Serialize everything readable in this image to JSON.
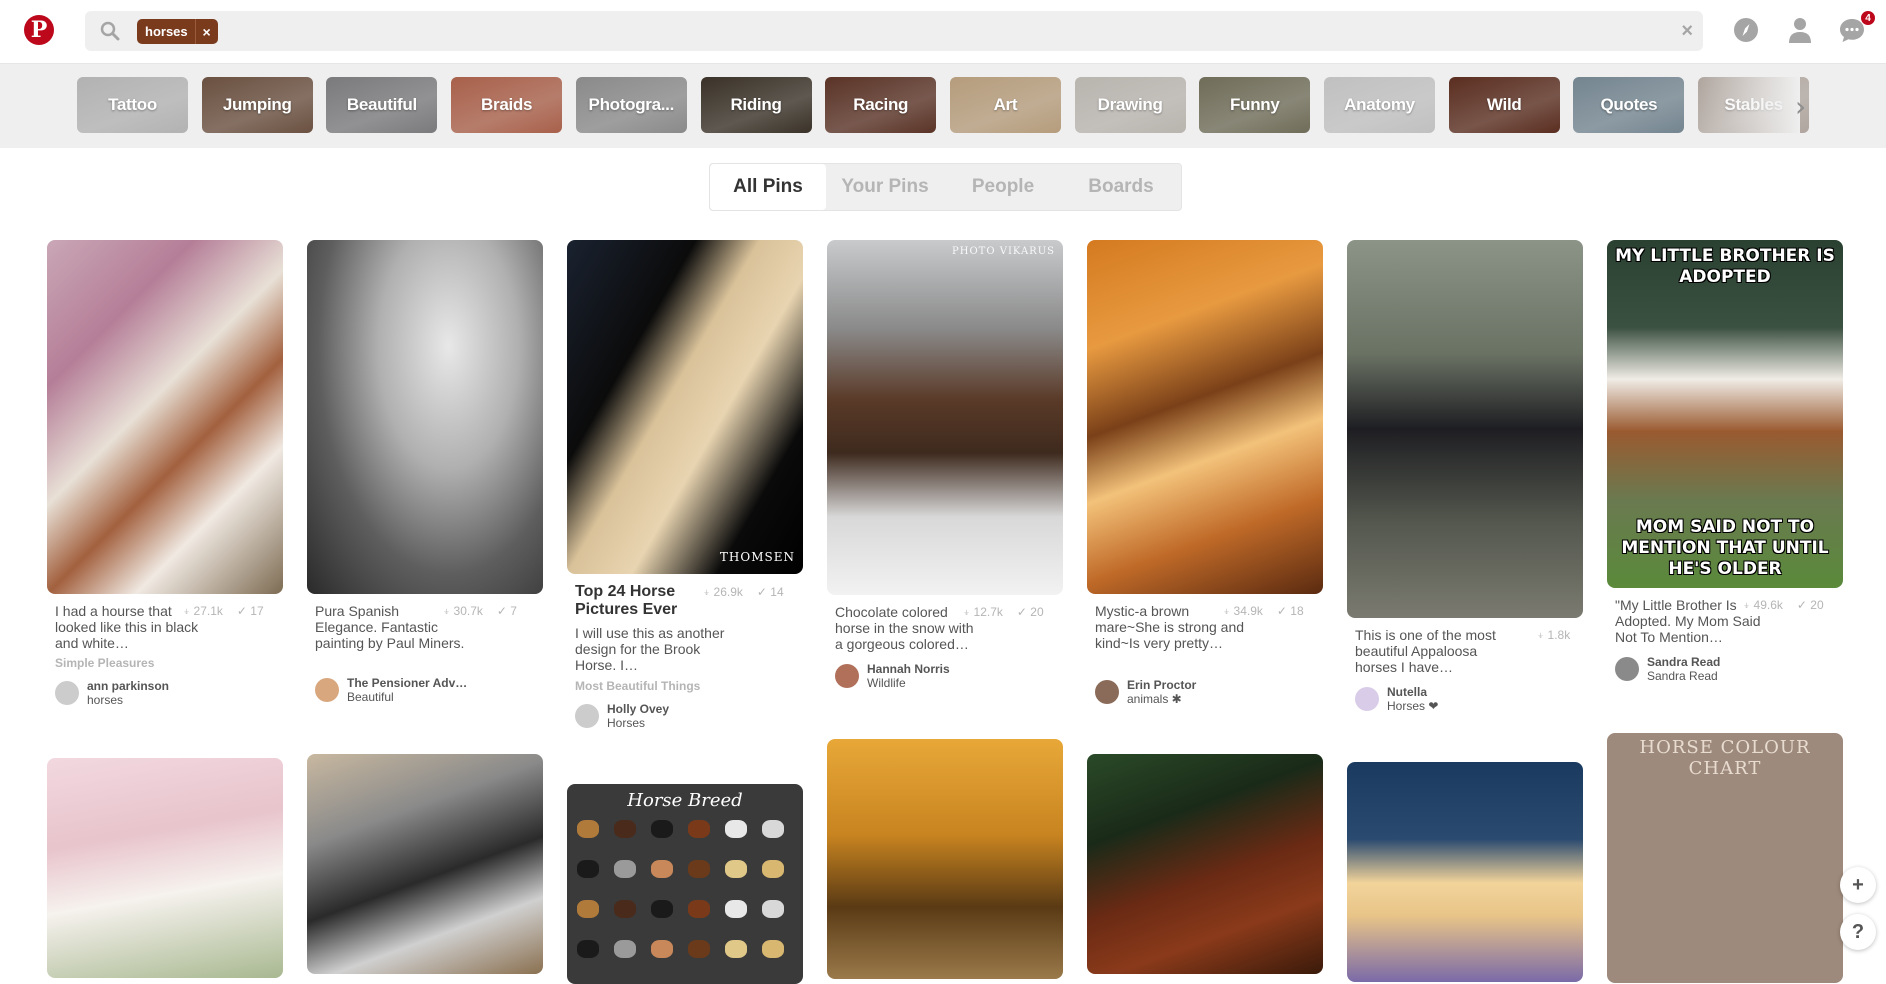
{
  "header": {
    "logo_glyph": "P",
    "search_chip": "horses",
    "chip_remove": "×",
    "clear_search": "×",
    "notification_count": "4",
    "brand_color": "#bd081c",
    "chip_color": "#7a3b1d",
    "icons": [
      "pinterest-logo",
      "search-icon",
      "compass-icon",
      "profile-icon",
      "messages-icon"
    ]
  },
  "guides": [
    {
      "label": "Tattoo",
      "color": "#b2b2b2"
    },
    {
      "label": "Jumping",
      "color": "#6a5040"
    },
    {
      "label": "Beautiful",
      "color": "#7a7a7c"
    },
    {
      "label": "Braids",
      "color": "#a8604a"
    },
    {
      "label": "Photogra...",
      "color": "#8a8a8a"
    },
    {
      "label": "Riding",
      "color": "#3a3228"
    },
    {
      "label": "Racing",
      "color": "#5a3326"
    },
    {
      "label": "Art",
      "color": "#b59c7c"
    },
    {
      "label": "Drawing",
      "color": "#b8b4ae"
    },
    {
      "label": "Funny",
      "color": "#6f6c58"
    },
    {
      "label": "Anatomy",
      "color": "#c0c0c0"
    },
    {
      "label": "Wild",
      "color": "#5a2e20"
    },
    {
      "label": "Quotes",
      "color": "#748590"
    },
    {
      "label": "Stables",
      "color": "#b0a69f"
    }
  ],
  "guide_next": "›",
  "tabs": [
    {
      "label": "All Pins",
      "active": true
    },
    {
      "label": "Your Pins",
      "active": false
    },
    {
      "label": "People",
      "active": false
    },
    {
      "label": "Boards",
      "active": false
    }
  ],
  "pins": [
    {
      "description": "I had a hourse that looked like this in black and white…",
      "repins": "27.1k",
      "likes": "17",
      "board": "Simple Pleasures",
      "user": "ann parkinson",
      "user_board": "horses",
      "image": "appaloosa-horse-blossoms"
    },
    {
      "description": "Pura Spanish Elegance. Fantastic painting by Paul Miners.",
      "repins": "30.7k",
      "likes": "7",
      "board": "",
      "user": "The Pensioner Adv…",
      "user_board": "Beautiful",
      "image": "grey-spanish-horse-painting"
    },
    {
      "title": "Top 24 Horse Pictures Ever",
      "description": "I will use this as another design for the Brook Horse. I…",
      "repins": "26.9k",
      "likes": "14",
      "board": "Most Beautiful Things",
      "user": "Holly Ovey",
      "user_board": "Horses",
      "image": "buckskin-horse-bridle",
      "watermark": "THOMSEN"
    },
    {
      "description": "Chocolate colored horse in the snow with a gorgeous colored…",
      "repins": "12.7k",
      "likes": "20",
      "board": "",
      "user": "Hannah Norris",
      "user_board": "Wildlife",
      "image": "chocolate-horse-snow",
      "watermark": "PHOTO VIKARUS"
    },
    {
      "description": "Mystic-a brown mare~She is strong and kind~Is very pretty…",
      "repins": "34.9k",
      "likes": "18",
      "board": "",
      "user": "Erin Proctor",
      "user_board": "animals ✱",
      "image": "chestnut-mare-autumn"
    },
    {
      "description": "This is one of the most beautiful Appaloosa horses I have…",
      "repins": "1.8k",
      "likes": "",
      "board": "",
      "user": "Nutella",
      "user_board": "Horses ❤",
      "image": "black-appaloosa-forest"
    },
    {
      "description": "\"My Little Brother Is Adopted. My Mom Said Not To Mention…",
      "repins": "49.6k",
      "likes": "20",
      "board": "",
      "user": "Sandra Read",
      "user_board": "Sandra Read",
      "image": "paint-horses-dog-meme",
      "meme_top": "MY LITTLE BROTHER IS ADOPTED",
      "meme_bottom": "MOM SAID NOT TO MENTION THAT UNTIL HE'S OLDER"
    }
  ],
  "pins_row2": [
    {
      "image": "white-horse-cherry-blossoms"
    },
    {
      "image": "spotted-pony-mane"
    },
    {
      "image": "horse-breed-chart",
      "overlay_title": "Horse Breed"
    },
    {
      "image": "rearing-horse-sunset"
    },
    {
      "image": "bay-horse-portrait"
    },
    {
      "image": "palomino-horse-lupines"
    },
    {
      "image": "horse-colour-chart",
      "overlay_title": "HORSE COLOUR CHART"
    }
  ],
  "floating": {
    "add": "+",
    "help": "?"
  }
}
